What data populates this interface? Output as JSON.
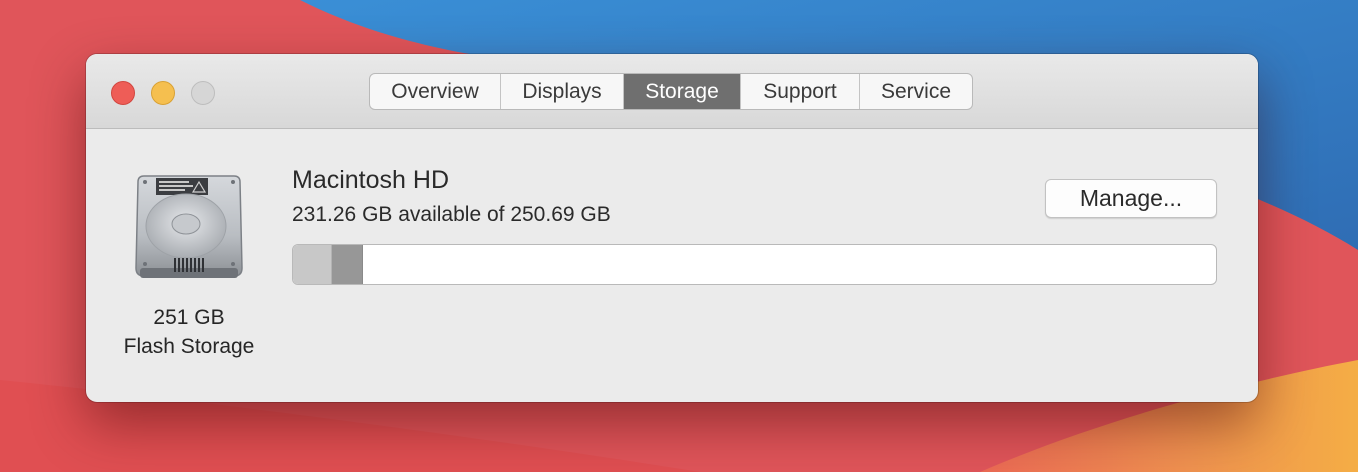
{
  "window": {
    "tabs": [
      {
        "label": "Overview",
        "active": false
      },
      {
        "label": "Displays",
        "active": false
      },
      {
        "label": "Storage",
        "active": true
      },
      {
        "label": "Support",
        "active": false
      },
      {
        "label": "Service",
        "active": false
      }
    ]
  },
  "device": {
    "capacity_label": "251 GB",
    "type_label": "Flash Storage",
    "icon": "hard-drive-icon"
  },
  "volume": {
    "name": "Macintosh HD",
    "availability_text": "231.26 GB available of 250.69 GB",
    "manage_label": "Manage...",
    "used_fraction": 0.078
  },
  "colors": {
    "active_tab": "#6f6f6f",
    "close": "#ee5d57",
    "minimize": "#f5bf4f",
    "zoom": "#d6d6d6"
  }
}
